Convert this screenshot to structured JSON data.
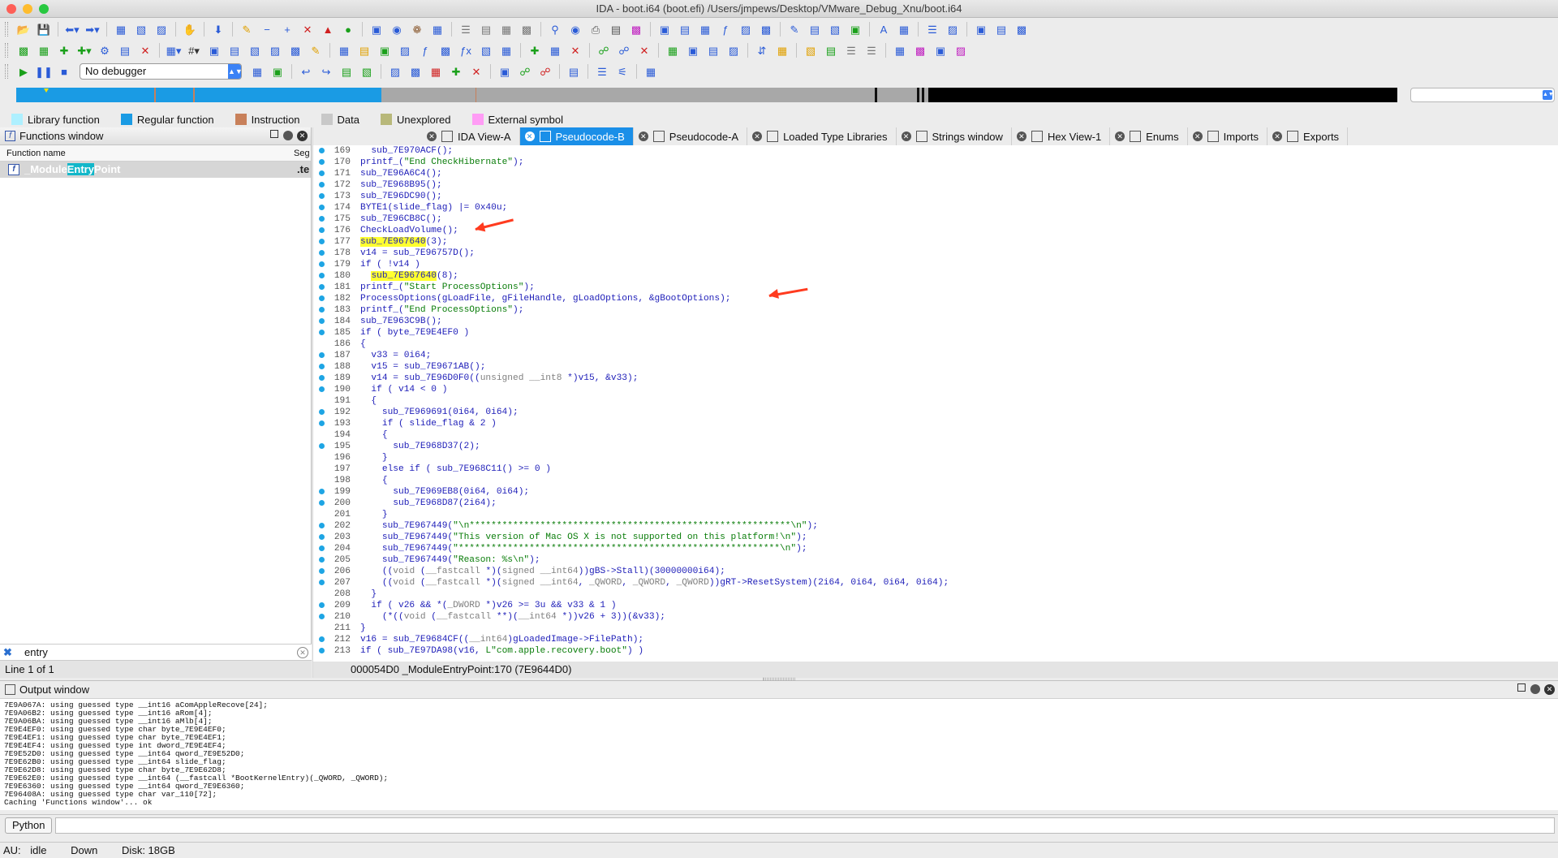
{
  "window": {
    "title": "IDA - boot.i64 (boot.efi) /Users/jmpews/Desktop/VMware_Debug_Xnu/boot.i64"
  },
  "debugger": {
    "selected": "No debugger"
  },
  "legend": [
    {
      "label": "Library function",
      "color": "#aef0ff"
    },
    {
      "label": "Regular function",
      "color": "#1a9be4"
    },
    {
      "label": "Instruction",
      "color": "#c8805a"
    },
    {
      "label": "Data",
      "color": "#c8c8c8"
    },
    {
      "label": "Unexplored",
      "color": "#b8b87a"
    },
    {
      "label": "External symbol",
      "color": "#ff9cf5"
    }
  ],
  "functions": {
    "title": "Functions window",
    "col_name": "Function name",
    "col_seg": "Seg",
    "rows": [
      {
        "name_pre": "_Module",
        "name_match": "Entry",
        "name_post": "Point",
        "seg": ".te"
      }
    ],
    "filter": "entry",
    "status": "Line 1 of 1"
  },
  "tabs": [
    {
      "label": "IDA View-A",
      "active": false
    },
    {
      "label": "Pseudocode-B",
      "active": true
    },
    {
      "label": "Pseudocode-A",
      "active": false
    },
    {
      "label": "Loaded Type Libraries",
      "active": false
    },
    {
      "label": "Strings window",
      "active": false
    },
    {
      "label": "Hex View-1",
      "active": false
    },
    {
      "label": "Enums",
      "active": false
    },
    {
      "label": "Imports",
      "active": false
    },
    {
      "label": "Exports",
      "active": false
    }
  ],
  "code": {
    "lines": [
      {
        "n": "169",
        "dot": true,
        "t": "  sub_7E970ACF();"
      },
      {
        "n": "170",
        "dot": true,
        "t": "printf_(\"End CheckHibernate\");"
      },
      {
        "n": "171",
        "dot": true,
        "t": "sub_7E96A6C4();"
      },
      {
        "n": "172",
        "dot": true,
        "t": "sub_7E968B95();"
      },
      {
        "n": "173",
        "dot": true,
        "t": "sub_7E96DC90();"
      },
      {
        "n": "174",
        "dot": true,
        "t": "BYTE1(slide_flag) |= 0x40u;"
      },
      {
        "n": "175",
        "dot": true,
        "t": "sub_7E96CB8C();"
      },
      {
        "n": "176",
        "dot": true,
        "t": "CheckLoadVolume();"
      },
      {
        "n": "177",
        "dot": true,
        "t": "sub_7E967640(3);"
      },
      {
        "n": "178",
        "dot": true,
        "t": "v14 = sub_7E96757D();"
      },
      {
        "n": "179",
        "dot": true,
        "t": "if ( !v14 )"
      },
      {
        "n": "180",
        "dot": true,
        "t": "  sub_7E967640(8);"
      },
      {
        "n": "181",
        "dot": true,
        "t": "printf_(\"Start ProcessOptions\");"
      },
      {
        "n": "182",
        "dot": true,
        "t": "ProcessOptions(gLoadFile, gFileHandle, gLoadOptions, &gBootOptions);"
      },
      {
        "n": "183",
        "dot": true,
        "t": "printf_(\"End ProcessOptions\");"
      },
      {
        "n": "184",
        "dot": true,
        "t": "sub_7E963C9B();"
      },
      {
        "n": "185",
        "dot": true,
        "t": "if ( byte_7E9E4EF0 )"
      },
      {
        "n": "186",
        "dot": false,
        "t": "{"
      },
      {
        "n": "187",
        "dot": true,
        "t": "  v33 = 0i64;"
      },
      {
        "n": "188",
        "dot": true,
        "t": "  v15 = sub_7E9671AB();"
      },
      {
        "n": "189",
        "dot": true,
        "t": "  v14 = sub_7E96D0F0((unsigned __int8 *)v15, &v33);"
      },
      {
        "n": "190",
        "dot": true,
        "t": "  if ( v14 < 0 )"
      },
      {
        "n": "191",
        "dot": false,
        "t": "  {"
      },
      {
        "n": "192",
        "dot": true,
        "t": "    sub_7E969691(0i64, 0i64);"
      },
      {
        "n": "193",
        "dot": true,
        "t": "    if ( slide_flag & 2 )"
      },
      {
        "n": "194",
        "dot": false,
        "t": "    {"
      },
      {
        "n": "195",
        "dot": true,
        "t": "      sub_7E968D37(2);"
      },
      {
        "n": "196",
        "dot": false,
        "t": "    }"
      },
      {
        "n": "197",
        "dot": false,
        "t": "    else if ( sub_7E968C11() >= 0 )"
      },
      {
        "n": "198",
        "dot": false,
        "t": "    {"
      },
      {
        "n": "199",
        "dot": true,
        "t": "      sub_7E969EB8(0i64, 0i64);"
      },
      {
        "n": "200",
        "dot": true,
        "t": "      sub_7E968D87(2i64);"
      },
      {
        "n": "201",
        "dot": false,
        "t": "    }"
      },
      {
        "n": "202",
        "dot": true,
        "t": "    sub_7E967449(\"\\n***********************************************************\\n\");"
      },
      {
        "n": "203",
        "dot": true,
        "t": "    sub_7E967449(\"This version of Mac OS X is not supported on this platform!\\n\");"
      },
      {
        "n": "204",
        "dot": true,
        "t": "    sub_7E967449(\"***********************************************************\\n\");"
      },
      {
        "n": "205",
        "dot": true,
        "t": "    sub_7E967449(\"Reason: %s\\n\");"
      },
      {
        "n": "206",
        "dot": true,
        "t": "    ((void (__fastcall *)(signed __int64))gBS->Stall)(30000000i64);"
      },
      {
        "n": "207",
        "dot": true,
        "t": "    ((void (__fastcall *)(signed __int64, _QWORD, _QWORD, _QWORD))gRT->ResetSystem)(2i64, 0i64, 0i64, 0i64);"
      },
      {
        "n": "208",
        "dot": false,
        "t": "  }"
      },
      {
        "n": "209",
        "dot": true,
        "t": "  if ( v26 && *(_DWORD *)v26 >= 3u && v33 & 1 )"
      },
      {
        "n": "210",
        "dot": true,
        "t": "    (*((void (__fastcall **)(__int64 *))v26 + 3))(&v33);"
      },
      {
        "n": "211",
        "dot": false,
        "t": "}"
      },
      {
        "n": "212",
        "dot": true,
        "t": "v16 = sub_7E9684CF((__int64)gLoadedImage->FilePath);"
      },
      {
        "n": "213",
        "dot": true,
        "t": "if ( sub_7E97DA98(v16, L\"com.apple.recovery.boot\") )"
      }
    ],
    "address": "000054D0 _ModuleEntryPoint:170 (7E9644D0)"
  },
  "output": {
    "title": "Output window",
    "lines": [
      "7E9A067A: using guessed type __int16 aComAppleRecove[24];",
      "7E9A06B2: using guessed type __int16 aRom[4];",
      "7E9A06BA: using guessed type __int16 aMlb[4];",
      "7E9E4EF0: using guessed type char byte_7E9E4EF0;",
      "7E9E4EF1: using guessed type char byte_7E9E4EF1;",
      "7E9E4EF4: using guessed type int dword_7E9E4EF4;",
      "7E9E52D0: using guessed type __int64 qword_7E9E52D0;",
      "7E9E62B0: using guessed type __int64 slide_flag;",
      "7E9E62D8: using guessed type char byte_7E9E62D8;",
      "7E9E62E0: using guessed type __int64 (__fastcall *BootKernelEntry)(_QWORD, _QWORD);",
      "7E9E6360: using guessed type __int64 qword_7E9E6360;",
      "7E96408A: using guessed type char var_110[72];",
      "Caching 'Functions window'... ok"
    ],
    "python_label": "Python"
  },
  "status": {
    "au": "AU:",
    "state": "idle",
    "dir": "Down",
    "disk": "Disk: 18GB"
  }
}
